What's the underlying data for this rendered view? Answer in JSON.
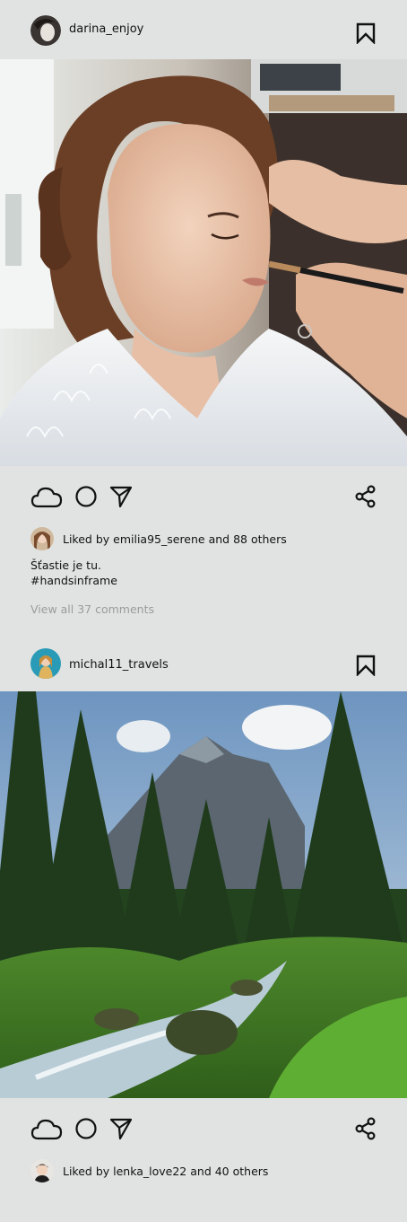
{
  "posts": [
    {
      "username": "darina_enjoy",
      "likes_text": "Liked by emilia95_serene and 88 others",
      "caption_line1": "Šťastie je tu.",
      "caption_line2": "#handsinframe",
      "view_comments": "View all 37 comments"
    },
    {
      "username": "michal11_travels",
      "likes_text": "Liked by lenka_love22 and 40 others"
    }
  ],
  "icons": {
    "bookmark": "bookmark-icon",
    "like": "cloud-like-icon",
    "comment": "circle-comment-icon",
    "send": "send-arrow-icon",
    "share": "share-icon"
  },
  "colors": {
    "background": "#e1e3e2",
    "muted_text": "#9a9c9c",
    "icon_stroke": "#111111"
  }
}
